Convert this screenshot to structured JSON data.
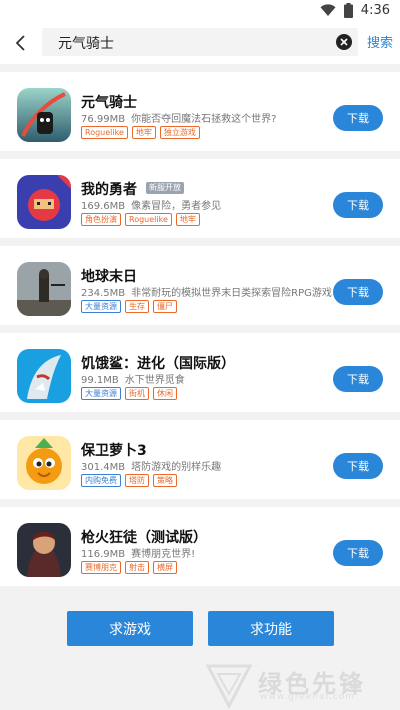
{
  "status_bar": {
    "time": "4:36",
    "icons": [
      "wifi-icon",
      "battery-icon"
    ]
  },
  "search": {
    "query": "元气骑士",
    "search_label": "搜索"
  },
  "apps": [
    {
      "name": "元气骑士",
      "size": "76.99MB",
      "desc": "你能否夺回魔法石拯救这个世界?",
      "tags": [
        "Roguelike",
        "地牢",
        "独立游戏"
      ],
      "tag_colors": [
        "orange",
        "orange",
        "orange"
      ],
      "badge": "",
      "download": "下载",
      "icon": "soul-knight-icon"
    },
    {
      "name": "我的勇者",
      "size": "169.6MB",
      "desc": "像素冒险，勇者参见",
      "tags": [
        "角色扮演",
        "Roguelike",
        "地牢"
      ],
      "tag_colors": [
        "orange",
        "orange",
        "orange"
      ],
      "badge": "新服开放",
      "download": "下载",
      "icon": "my-hero-icon"
    },
    {
      "name": "地球末日",
      "size": "234.5MB",
      "desc": "非常耐玩的模拟世界末日类探索冒险RPG游戏",
      "tags": [
        "大量资源",
        "生存",
        "僵尸"
      ],
      "tag_colors": [
        "blue",
        "orange",
        "orange"
      ],
      "badge": "",
      "download": "下载",
      "icon": "last-day-on-earth-icon"
    },
    {
      "name": "饥饿鲨：进化（国际版）",
      "size": "99.1MB",
      "desc": "水下世界觅食",
      "tags": [
        "大量资源",
        "街机",
        "休闲"
      ],
      "tag_colors": [
        "blue",
        "orange",
        "orange"
      ],
      "badge": "",
      "download": "下载",
      "icon": "hungry-shark-icon"
    },
    {
      "name": "保卫萝卜3",
      "size": "301.4MB",
      "desc": "塔防游戏的别样乐趣",
      "tags": [
        "内购免费",
        "塔防",
        "策略"
      ],
      "tag_colors": [
        "blue",
        "orange",
        "orange"
      ],
      "badge": "",
      "download": "下载",
      "icon": "carrot-fantasy-icon"
    },
    {
      "name": "枪火狂徒（测试版）",
      "size": "116.9MB",
      "desc": "赛博朋克世界!",
      "tags": [
        "赛博朋克",
        "射击",
        "横屏"
      ],
      "tag_colors": [
        "orange",
        "orange",
        "orange"
      ],
      "badge": "",
      "download": "下载",
      "icon": "gunfire-icon"
    }
  ],
  "bottom": {
    "request_game": "求游戏",
    "request_feature": "求功能"
  },
  "watermark": {
    "text": "绿色先锋",
    "sub": "www.greenxf.com"
  },
  "colors": {
    "accent": "#2a86d8",
    "tag_orange": "#e96a2b",
    "tag_blue": "#3b7fd6"
  }
}
